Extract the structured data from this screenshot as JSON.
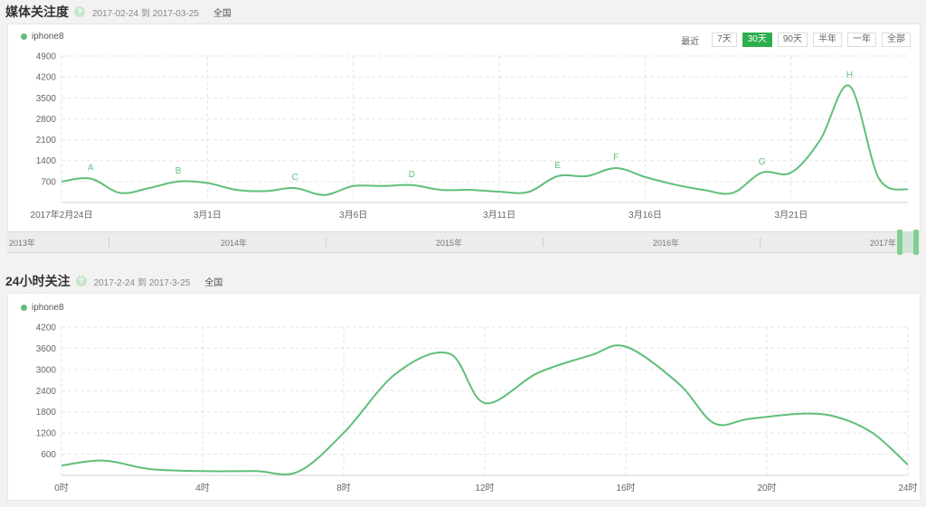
{
  "media": {
    "title": "媒体关注度",
    "help": "?",
    "date_start": "2017-02-24",
    "date_to": "到",
    "date_end": "2017-03-25",
    "region": "全国",
    "legend": "iphone8",
    "range_label": "最近",
    "range_buttons": [
      "7天",
      "30天",
      "90天",
      "半年",
      "一年",
      "全部"
    ],
    "active_range": "30天"
  },
  "navigator": {
    "years": [
      "2013年",
      "2014年",
      "2015年",
      "2016年",
      "2017年"
    ]
  },
  "hourly": {
    "title": "24小时关注",
    "help": "?",
    "date_start": "2017-2-24",
    "date_to": "到",
    "date_end": "2017-3-25",
    "region": "全国",
    "legend": "iphone8"
  },
  "colors": {
    "line": "#5fbf7a",
    "accent": "#2eae4e",
    "grid": "#e5e5e5"
  },
  "chart_data": [
    {
      "type": "line",
      "series": [
        {
          "name": "iphone8",
          "values": [
            700,
            800,
            320,
            480,
            700,
            650,
            420,
            380,
            480,
            250,
            550,
            550,
            580,
            420,
            420,
            360,
            350,
            880,
            880,
            1150,
            850,
            600,
            420,
            320,
            1000,
            1000,
            2100,
            3900,
            820,
            430
          ]
        }
      ],
      "x": [
        0,
        1,
        2,
        3,
        4,
        5,
        6,
        7,
        8,
        9,
        10,
        11,
        12,
        13,
        14,
        15,
        16,
        17,
        18,
        19,
        20,
        21,
        22,
        23,
        24,
        25,
        26,
        27,
        28,
        29
      ],
      "x_tick_positions": [
        0,
        5,
        10,
        15,
        20,
        25
      ],
      "x_tick_labels": [
        "2017年2月24日",
        "3月1日",
        "3月6日",
        "3月11日",
        "3月16日",
        "3月21日"
      ],
      "y_ticks": [
        700,
        1400,
        2100,
        2800,
        3500,
        4200,
        4900
      ],
      "ylim": [
        0,
        4900
      ],
      "annotations": [
        {
          "label": "A",
          "x": 1,
          "y": 800
        },
        {
          "label": "B",
          "x": 4,
          "y": 700
        },
        {
          "label": "C",
          "x": 8,
          "y": 480
        },
        {
          "label": "D",
          "x": 12,
          "y": 580
        },
        {
          "label": "E",
          "x": 17,
          "y": 880
        },
        {
          "label": "F",
          "x": 19,
          "y": 1150
        },
        {
          "label": "G",
          "x": 24,
          "y": 1000
        },
        {
          "label": "H",
          "x": 27,
          "y": 3900
        }
      ]
    },
    {
      "type": "line",
      "series": [
        {
          "name": "iphone8",
          "values": [
            280,
            420,
            180,
            120,
            120,
            100,
            1200,
            2900,
            3450,
            2050,
            2900,
            3400,
            3650,
            2600,
            1480,
            1600,
            1750,
            1650,
            1200,
            300
          ]
        }
      ],
      "x": [
        0,
        1.2,
        2.5,
        4,
        5.5,
        6.7,
        8,
        9.5,
        11,
        12,
        13.5,
        15,
        16,
        17.5,
        18.5,
        19.5,
        21,
        22,
        23,
        24
      ],
      "x_tick_positions": [
        0,
        4,
        8,
        12,
        16,
        20,
        24
      ],
      "x_tick_labels": [
        "0时",
        "4时",
        "8时",
        "12时",
        "16时",
        "20时",
        "24时"
      ],
      "y_ticks": [
        600,
        1200,
        1800,
        2400,
        3000,
        3600,
        4200
      ],
      "ylim": [
        0,
        4200
      ]
    }
  ]
}
